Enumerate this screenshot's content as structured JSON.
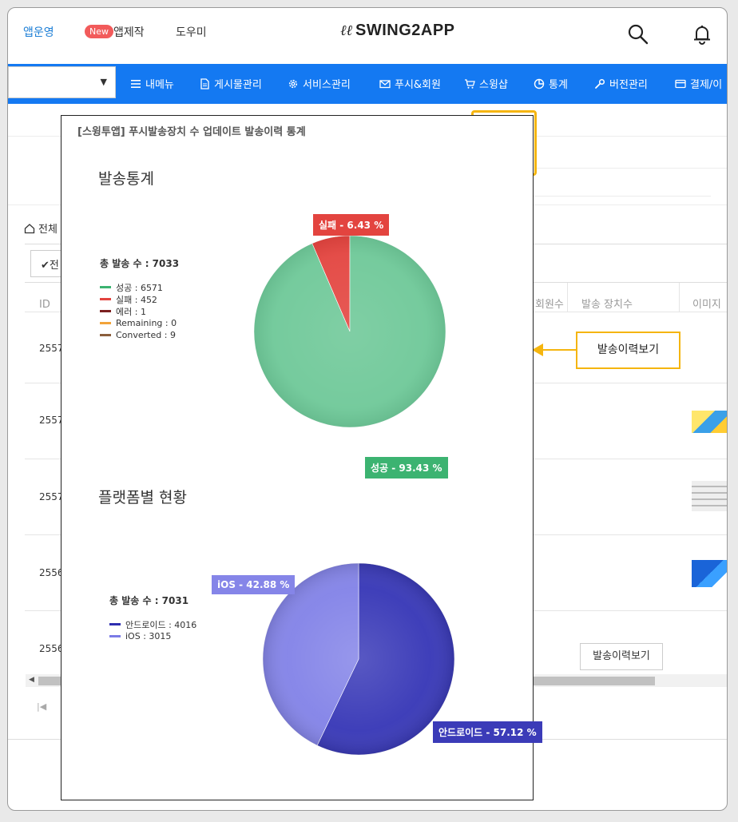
{
  "header": {
    "nav": [
      "앱운영",
      "앱제작",
      "도우미"
    ],
    "new_badge": "New",
    "logo_text": "SWING2APP"
  },
  "menu": {
    "items": [
      "내메뉴",
      "게시물관리",
      "서비스관리",
      "푸시&회원",
      "스윙샵",
      "통계",
      "버전관리",
      "결제/이"
    ]
  },
  "page": {
    "breadcrumb": "전체",
    "check_button": "전",
    "columns": [
      "ID",
      "회원수",
      "발송 장치수",
      "이미지"
    ],
    "rows": [
      {
        "id": "2557"
      },
      {
        "id": "2557"
      },
      {
        "id": "2557"
      },
      {
        "id": "2556"
      },
      {
        "id": "2556"
      }
    ],
    "history_button": "발송이력보기"
  },
  "callout": {
    "text": "발송이력보기"
  },
  "modal": {
    "title": "[스윙투앱] 푸시발송장치 수 업데이트 발송이력 통계",
    "section1_title": "발송통계",
    "section2_title": "플랫폼별 현황"
  },
  "chart_data": [
    {
      "type": "pie",
      "title": "발송통계",
      "total_label": "총 발송 수 : 7033",
      "legend": [
        {
          "label": "성공 : 6571",
          "color": "#3cb371"
        },
        {
          "label": "실패 : 452",
          "color": "#e3443f"
        },
        {
          "label": "에러 : 1",
          "color": "#7b2020"
        },
        {
          "label": "Remaining : 0",
          "color": "#f2a33a"
        },
        {
          "label": "Converted : 9",
          "color": "#8b5e3c"
        }
      ],
      "slices": [
        {
          "name": "성공",
          "value": 93.43,
          "label": "성공 - 93.43 %",
          "color": "#6ec898"
        },
        {
          "name": "실패",
          "value": 6.43,
          "label": "실패 - 6.43 %",
          "color": "#e3443f"
        }
      ]
    },
    {
      "type": "pie",
      "title": "플랫폼별 현황",
      "total_label": "총 발송 수 : 7031",
      "legend": [
        {
          "label": "안드로이드 : 4016",
          "color": "#2e2eb0"
        },
        {
          "label": "iOS : 3015",
          "color": "#7b7be6"
        }
      ],
      "slices": [
        {
          "name": "안드로이드",
          "value": 57.12,
          "label": "안드로이드 - 57.12 %",
          "color": "#3b3bb8"
        },
        {
          "name": "iOS",
          "value": 42.88,
          "label": "iOS - 42.88 %",
          "color": "#8585e8"
        }
      ]
    }
  ]
}
